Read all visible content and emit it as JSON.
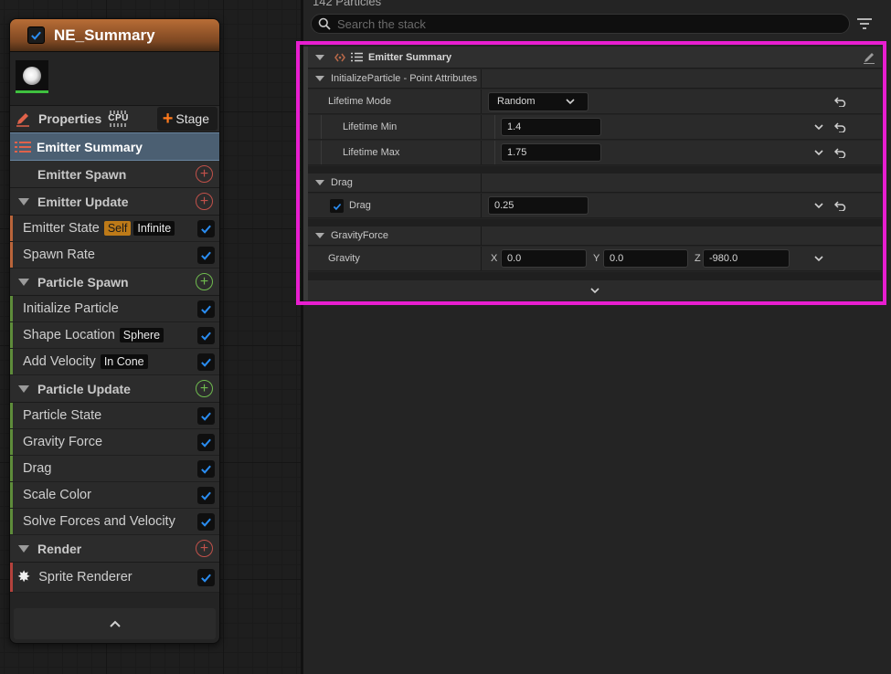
{
  "node": {
    "title": "NE_Summary",
    "properties_label": "Properties",
    "cpu_label": "CPU",
    "stage_label": "Stage",
    "summary_label": "Emitter Summary",
    "emitter_spawn_label": "Emitter Spawn",
    "groups": {
      "emitter_update": "Emitter Update",
      "particle_spawn": "Particle Spawn",
      "particle_update": "Particle Update",
      "render": "Render"
    },
    "modules": {
      "emitter_state": "Emitter State",
      "emitter_state_tag1": "Self",
      "emitter_state_tag2": "Infinite",
      "spawn_rate": "Spawn Rate",
      "initialize_particle": "Initialize Particle",
      "shape_location": "Shape Location",
      "shape_location_tag": "Sphere",
      "add_velocity": "Add Velocity",
      "add_velocity_tag": "In Cone",
      "particle_state": "Particle State",
      "gravity_force": "Gravity Force",
      "drag": "Drag",
      "scale_color": "Scale Color",
      "solve_forces": "Solve Forces and Velocity",
      "sprite_renderer": "Sprite Renderer"
    }
  },
  "panel": {
    "particle_count": "142 Particles",
    "search_placeholder": "Search the stack",
    "stack_title": "Emitter Summary",
    "sections": {
      "init_particle": "InitializeParticle - Point Attributes",
      "drag": "Drag",
      "gravity_force": "GravityForce"
    },
    "rows": {
      "lifetime_mode_label": "Lifetime Mode",
      "lifetime_mode_value": "Random",
      "lifetime_min_label": "Lifetime Min",
      "lifetime_min_value": "1.4",
      "lifetime_max_label": "Lifetime Max",
      "lifetime_max_value": "1.75",
      "drag_label": "Drag",
      "drag_value": "0.25",
      "gravity_label": "Gravity",
      "gravity_x_label": "X",
      "gravity_x": "0.0",
      "gravity_y_label": "Y",
      "gravity_y": "0.0",
      "gravity_z_label": "Z",
      "gravity_z": "-980.0"
    }
  },
  "colors": {
    "accent_highlight": "#e81ed0",
    "checkbox_blue": "#2a8cf0",
    "node_title": "#9a5a2c",
    "summary_selected": "#4b5f72"
  }
}
